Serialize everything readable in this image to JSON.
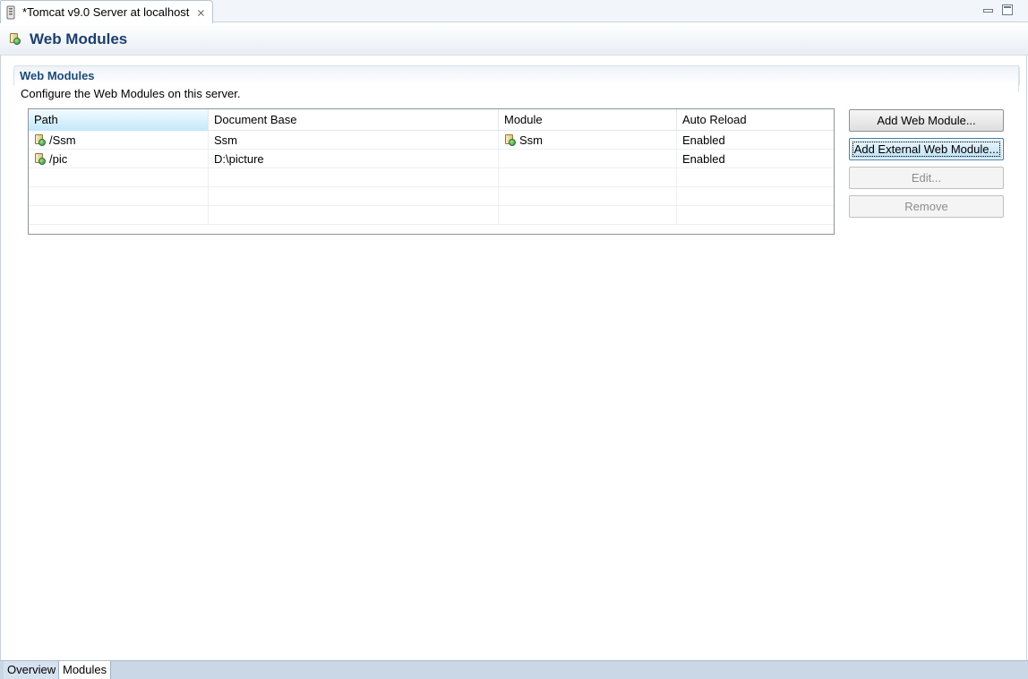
{
  "editor_tab": {
    "title": "*Tomcat v9.0 Server at localhost",
    "close_glyph": "⨯"
  },
  "header": {
    "title": "Web Modules"
  },
  "section": {
    "title": "Web Modules",
    "description": "Configure the Web Modules on this server."
  },
  "table": {
    "columns": [
      "Path",
      "Document Base",
      "Module",
      "Auto Reload"
    ],
    "rows": [
      {
        "path": "/Ssm",
        "document_base": "Ssm",
        "module": "Ssm",
        "auto_reload": "Enabled"
      },
      {
        "path": "/pic",
        "document_base": "D:\\picture",
        "module": "",
        "auto_reload": "Enabled"
      }
    ]
  },
  "buttons": {
    "add_web_module": "Add Web Module...",
    "add_external_web_module": "Add External Web Module...",
    "edit": "Edit...",
    "remove": "Remove"
  },
  "page_tabs": {
    "overview": "Overview",
    "modules": "Modules"
  },
  "icons": {
    "tab_icon": "server-icon",
    "header_icon": "web-module-icon",
    "row_icon": "web-module-icon"
  }
}
